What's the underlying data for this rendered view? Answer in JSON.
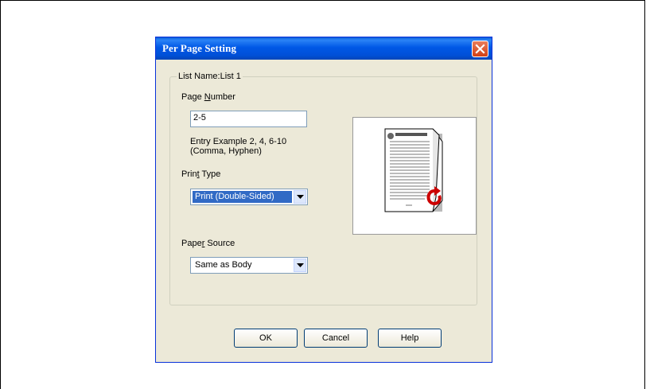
{
  "dialog": {
    "title": "Per Page Setting",
    "group_label": "List Name:List 1",
    "page_number": {
      "label_pre": "Page ",
      "label_mnemonic": "N",
      "label_post": "umber",
      "value": "2-5"
    },
    "entry_example_line1": "Entry Example 2, 4, 6-10",
    "entry_example_line2": "(Comma, Hyphen)",
    "print_type": {
      "label_pre": "Prin",
      "label_mnemonic": "t",
      "label_post": " Type",
      "value": "Print (Double-Sided)"
    },
    "paper_source": {
      "label_pre": "Pape",
      "label_mnemonic": "r",
      "label_post": " Source",
      "value": "Same as Body"
    },
    "buttons": {
      "ok": "OK",
      "cancel": "Cancel",
      "help": "Help"
    },
    "colors": {
      "title_bar": "#0058e6",
      "face": "#ece9d8",
      "selection": "#316ac5"
    },
    "preview_icon": "double-sided-page-icon"
  }
}
